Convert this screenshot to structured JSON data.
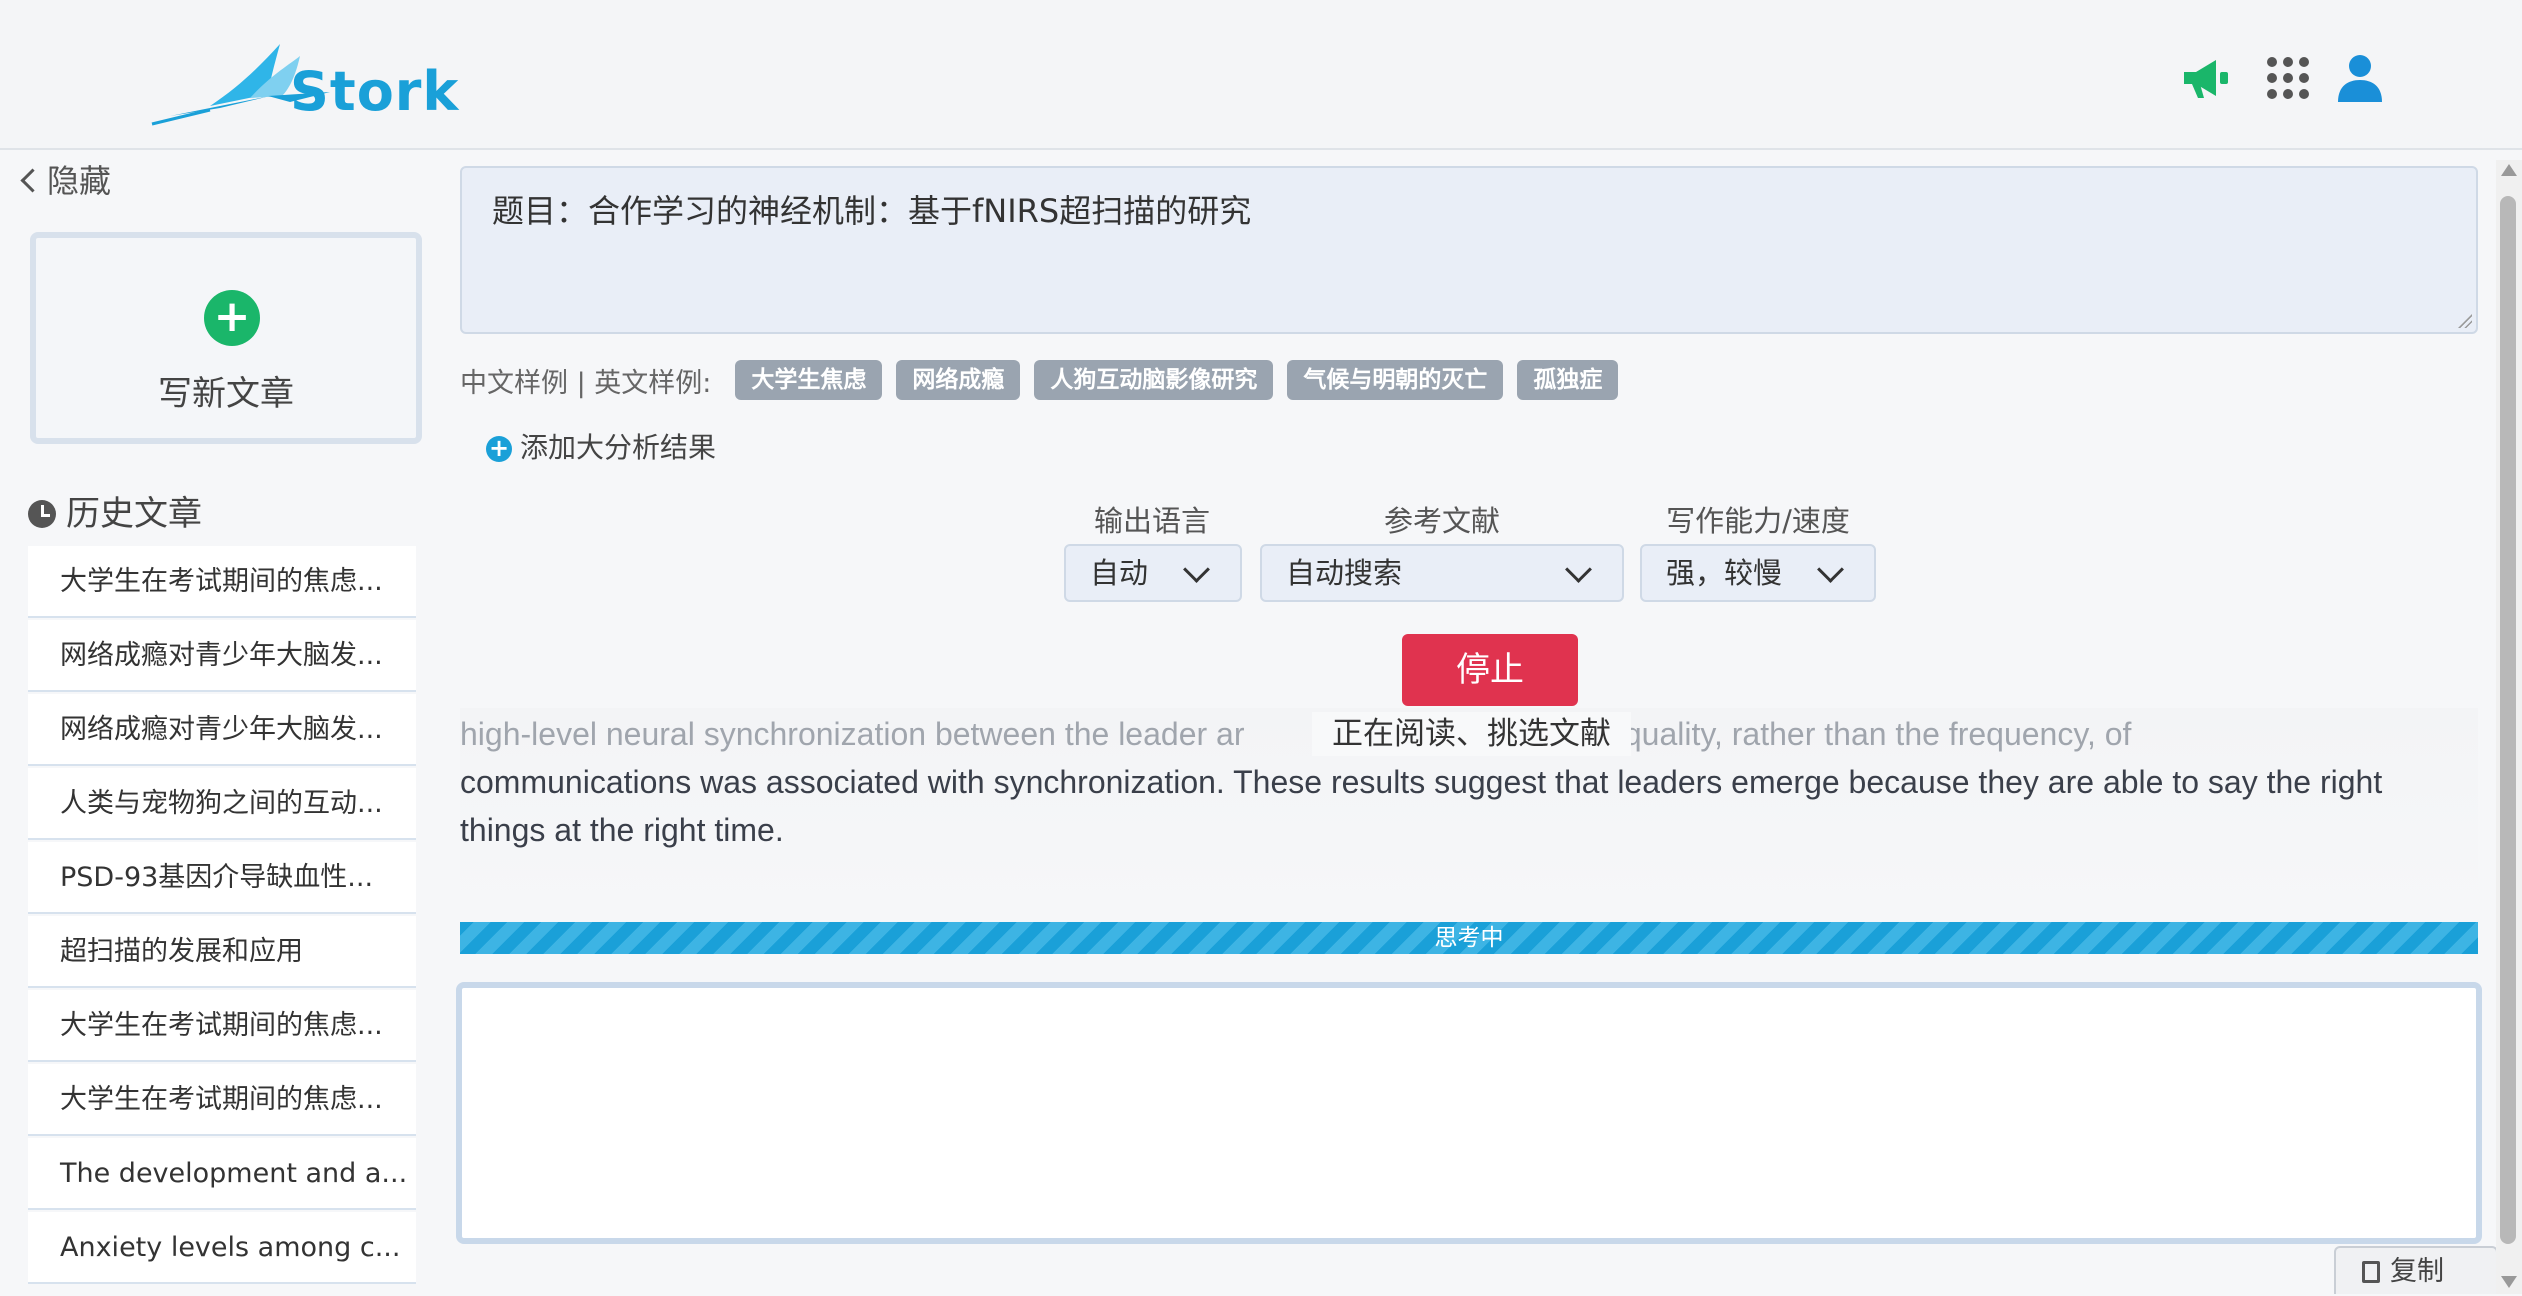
{
  "brand": {
    "name": "Stork"
  },
  "header": {
    "icons": [
      "megaphone-icon",
      "apps-grid-icon",
      "user-icon"
    ],
    "colors": {
      "megaphone": "#1ab66a",
      "apps": "#555555",
      "user": "#1a8fd8"
    }
  },
  "sidebar": {
    "hide_label": "隐藏",
    "new_article_label": "写新文章",
    "history_title": "历史文章",
    "history": [
      "大学生在考试期间的焦虑...",
      "网络成瘾对青少年大脑发...",
      "网络成瘾对青少年大脑发...",
      "人类与宠物狗之间的互动...",
      "PSD-93基因介导缺血性...",
      "超扫描的发展和应用",
      "大学生在考试期间的焦虑...",
      "大学生在考试期间的焦虑...",
      "The development and a...",
      "Anxiety levels among c..."
    ]
  },
  "main": {
    "topic": "题目：合作学习的神经机制：基于fNIRS超扫描的研究",
    "examples_label": "中文样例 | 英文样例:",
    "example_tags": [
      "大学生焦虑",
      "网络成瘾",
      "人狗互动脑影像研究",
      "气候与明朝的灭亡",
      "孤独症"
    ],
    "add_analysis": "添加大分析结果",
    "options": {
      "language": {
        "label": "输出语言",
        "value": "自动"
      },
      "references": {
        "label": "参考文献",
        "value": "自动搜索"
      },
      "ability": {
        "label": "写作能力/速度",
        "value": "强，较慢"
      }
    },
    "stop_label": "停止",
    "status_overlay": "正在阅读、挑选文献",
    "output_line1_left": "high-level neural synchronization between the leader ar",
    "output_line1_right": "the quality, rather than the frequency, of",
    "output_rest": "communications was associated with synchronization. These results suggest that leaders emerge because they are able to say the right things at the right time.",
    "progress_label": "思考中",
    "copy_label": "复制",
    "accent_color": "#1aa0d8",
    "stop_color": "#e0334f"
  }
}
